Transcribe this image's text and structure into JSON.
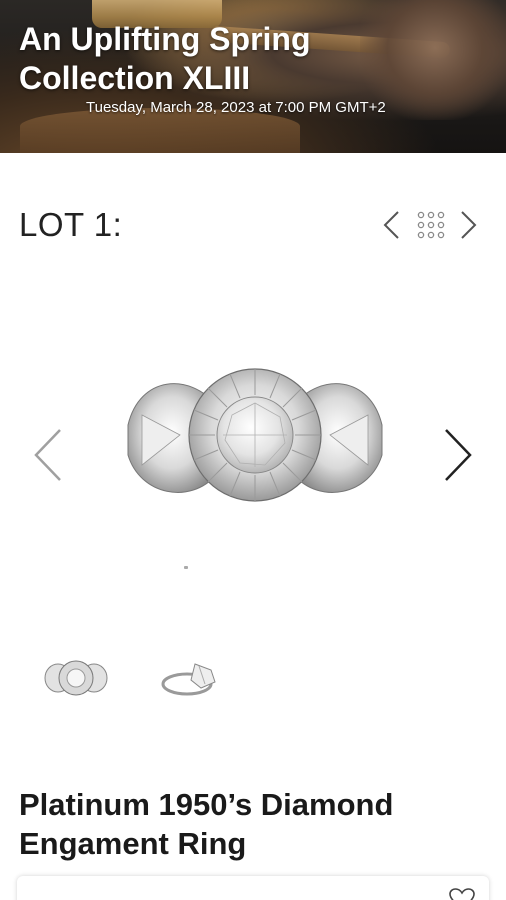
{
  "banner": {
    "title": "An Uplifting Spring Collection XLIII",
    "date": "Tuesday, March 28, 2023 at 7:00 PM GMT+2"
  },
  "lot": {
    "label": "LOT 1:",
    "icons": {
      "prev": "chevron-left-icon",
      "grid": "grid-icon",
      "next": "chevron-right-icon"
    }
  },
  "gallery": {
    "main_image": "diamond-ring-front",
    "thumbnails": [
      "diamond-ring-front",
      "diamond-ring-side"
    ],
    "icons": {
      "prev": "chevron-left-icon",
      "next": "chevron-right-icon"
    }
  },
  "item": {
    "title": "Platinum 1950’s Diamond Engament Ring"
  },
  "card": {
    "icons": {
      "favorite": "heart-icon"
    }
  },
  "colors": {
    "text": "#1a1a1a",
    "banner_text": "#ffffff",
    "chevron": "#999999"
  }
}
